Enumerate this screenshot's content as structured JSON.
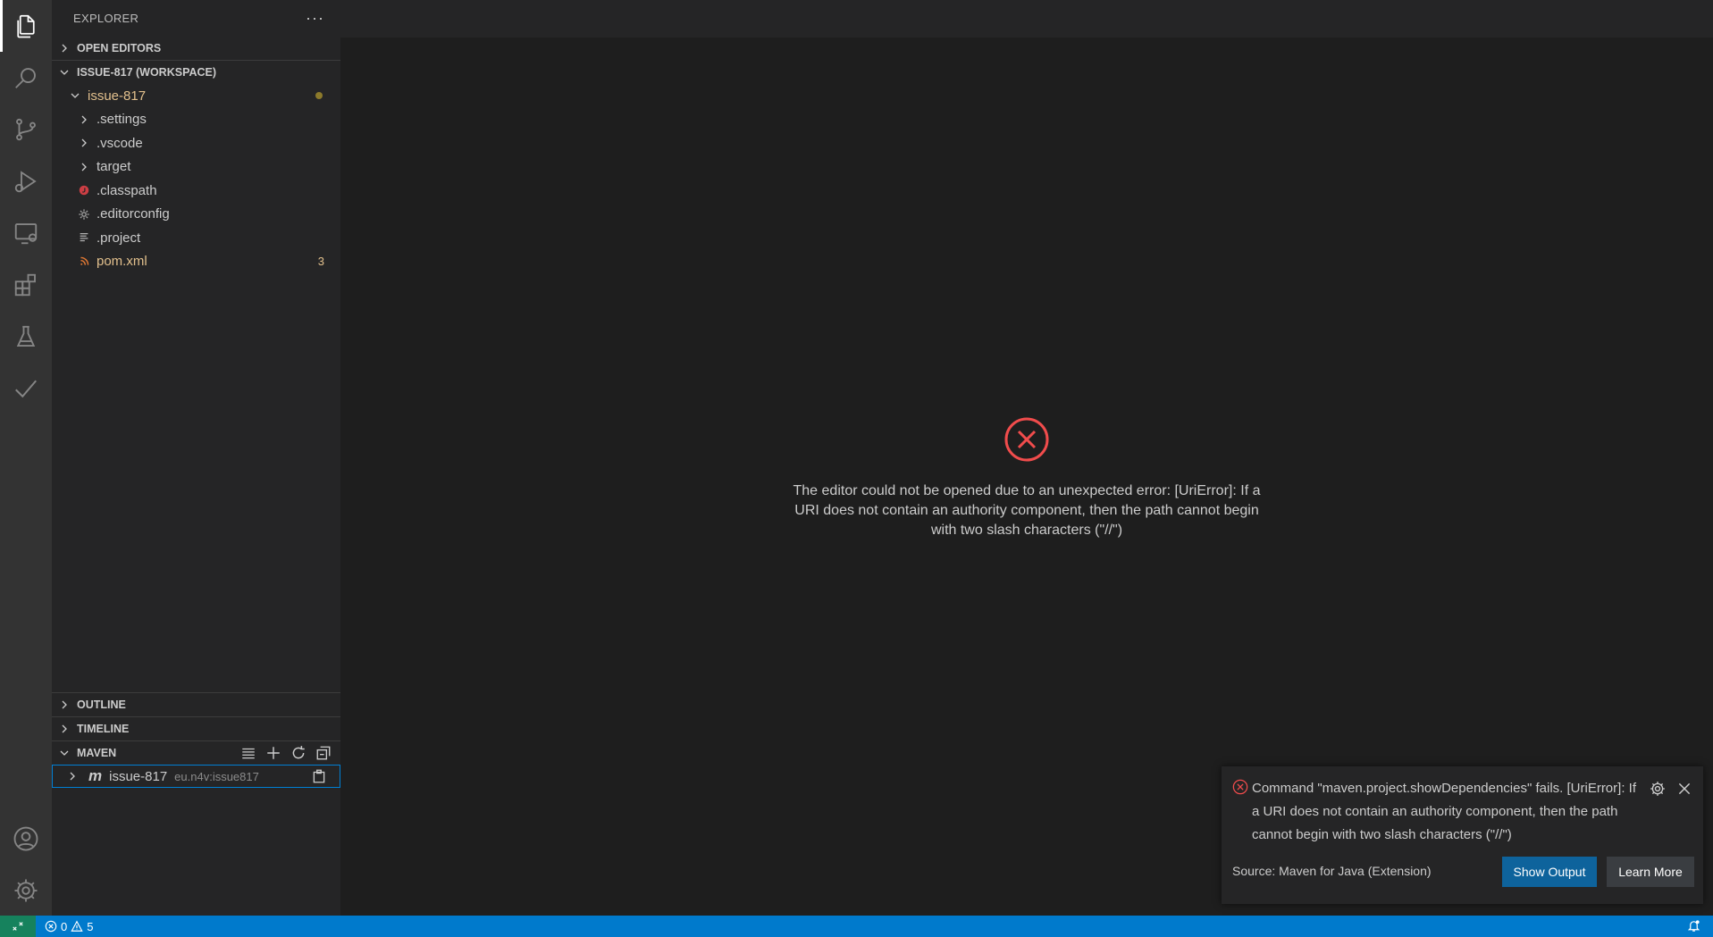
{
  "sidebar": {
    "title": "EXPLORER",
    "more": "···",
    "open_editors": "OPEN EDITORS",
    "workspace": "ISSUE-817 (WORKSPACE)",
    "root_folder": "issue-817",
    "items": [
      {
        "label": ".settings",
        "type": "folder"
      },
      {
        "label": ".vscode",
        "type": "folder"
      },
      {
        "label": "target",
        "type": "folder"
      },
      {
        "label": ".classpath",
        "type": "file"
      },
      {
        "label": ".editorconfig",
        "type": "file"
      },
      {
        "label": ".project",
        "type": "file"
      },
      {
        "label": "pom.xml",
        "type": "file",
        "badge": "3"
      }
    ],
    "outline": "OUTLINE",
    "timeline": "TIMELINE",
    "maven": "MAVEN",
    "maven_project": {
      "name": "issue-817",
      "id": "eu.n4v:issue817"
    }
  },
  "editor": {
    "error_message": "The editor could not be opened due to an unexpected error: [UriError]: If a URI does not contain an authority component, then the path cannot begin with two slash characters (\"//\")"
  },
  "notification": {
    "message": "Command \"maven.project.showDependencies\" fails. [UriError]: If a URI does not contain an authority component, then the path cannot begin with two slash characters (\"//\")",
    "source": "Source: Maven for Java (Extension)",
    "primary_button": "Show Output",
    "secondary_button": "Learn More"
  },
  "status_bar": {
    "errors": "0",
    "warnings": "5"
  },
  "colors": {
    "accent": "#007acc",
    "error": "#f14c4c",
    "modified": "#e2c08d",
    "remote": "#16825d"
  }
}
